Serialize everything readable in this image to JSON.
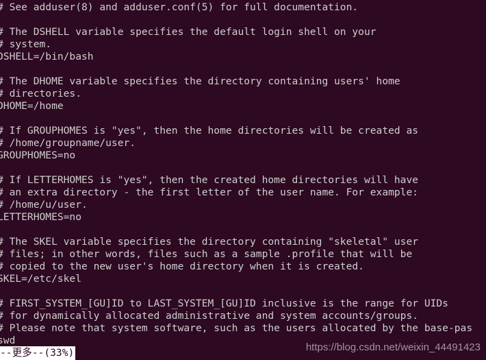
{
  "terminal": {
    "background_color": "#2d0922",
    "foreground_color": "#d0cfcc",
    "columns": 78,
    "rows": 29,
    "lines": [
      "# See adduser(8) and adduser.conf(5) for full documentation.",
      "",
      "# The DSHELL variable specifies the default login shell on your",
      "# system.",
      "DSHELL=/bin/bash",
      "",
      "# The DHOME variable specifies the directory containing users' home",
      "# directories.",
      "DHOME=/home",
      "",
      "# If GROUPHOMES is \"yes\", then the home directories will be created as",
      "# /home/groupname/user.",
      "GROUPHOMES=no",
      "",
      "# If LETTERHOMES is \"yes\", then the created home directories will have",
      "# an extra directory - the first letter of the user name. For example:",
      "# /home/u/user.",
      "LETTERHOMES=no",
      "",
      "# The SKEL variable specifies the directory containing \"skeletal\" user",
      "# files; in other words, files such as a sample .profile that will be",
      "# copied to the new user's home directory when it is created.",
      "SKEL=/etc/skel",
      "",
      "# FIRST_SYSTEM_[GU]ID to LAST_SYSTEM_[GU]ID inclusive is the range for UIDs",
      "# for dynamically allocated administrative and system accounts/groups.",
      "# Please note that system software, such as the users allocated by the base-pas",
      "swd"
    ]
  },
  "status_bar": {
    "text": "--更多--(33%)",
    "percent": "33%",
    "background_color": "#ffffff",
    "text_color": "#2d0922"
  },
  "watermark": {
    "text": "https://blog.csdn.net/weixin_44491423",
    "color": "#cfc7cc"
  }
}
